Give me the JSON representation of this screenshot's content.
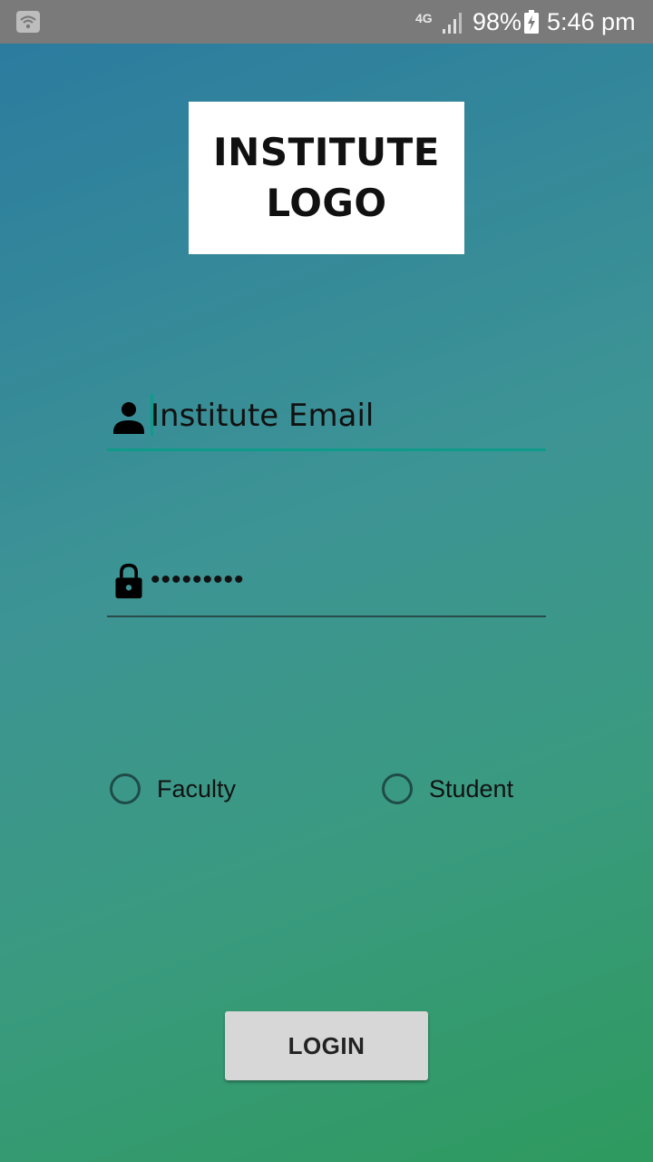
{
  "status_bar": {
    "network_type": "4G",
    "battery_percent": "98%",
    "time": "5:46 pm",
    "icons": [
      "wifi-icon",
      "signal-icon",
      "battery-charging-icon"
    ]
  },
  "logo": {
    "line1": "INSTITUTE",
    "line2": "LOGO"
  },
  "email_field": {
    "placeholder": "Institute Email",
    "value": "",
    "icon": "person-icon"
  },
  "password_field": {
    "masked_value": "•••••••••",
    "icon": "lock-icon"
  },
  "role_options": {
    "faculty_label": "Faculty",
    "student_label": "Student",
    "selected": null
  },
  "login_button": {
    "label": "LOGIN"
  },
  "colors": {
    "accent": "#0e9b8a",
    "status_bar": "#7a7a7a",
    "gradient_top": "#2a7aa0",
    "gradient_bottom": "#2e9a5e",
    "button_bg": "#d7d7d7"
  }
}
